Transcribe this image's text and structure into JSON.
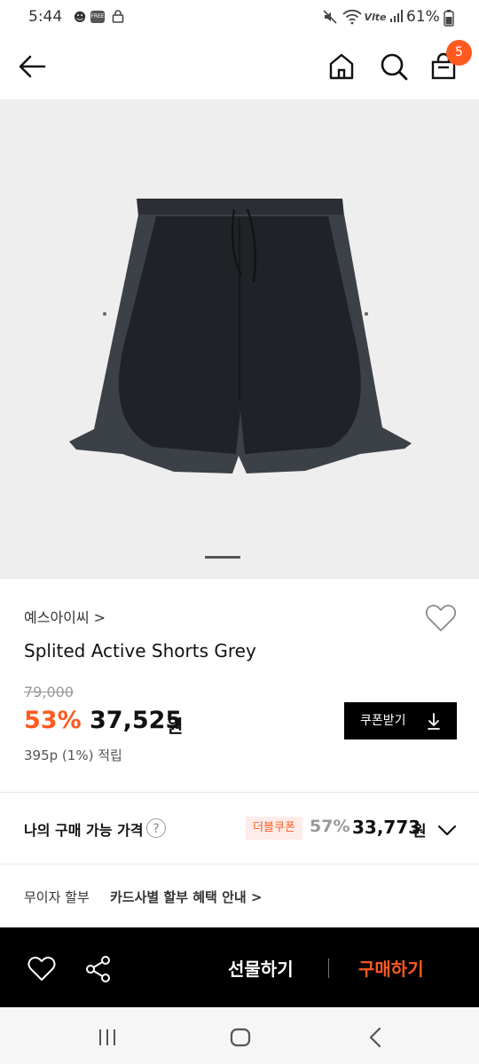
{
  "status_bar": {
    "time": "5:44",
    "battery_percent": "61%",
    "icons": [
      "person-walk-icon",
      "free-badge-icon",
      "lock-icon",
      "mute-icon",
      "wifi-icon",
      "volte-icon",
      "signal-icon",
      "battery-icon"
    ]
  },
  "header": {
    "cart_count": "5",
    "icons": [
      "back-arrow-icon",
      "home-icon",
      "search-icon",
      "cart-icon"
    ]
  },
  "gallery": {
    "slide_index": 1,
    "slide_count": 2
  },
  "product": {
    "brand": "예스아이씨 >",
    "title": "Splited Active Shorts Grey",
    "original_price": "79,000",
    "discount": "53%",
    "price": "37,525",
    "currency": "원",
    "points": "395p (1%) 적립",
    "coupon_button": "쿠폰받기"
  },
  "my_best_price": {
    "label": "나의 구매 가능 가격",
    "badge": "더블쿠폰",
    "discount": "57%",
    "price": "33,773",
    "currency": "원"
  },
  "installment": {
    "label": "무이자 할부",
    "link": "카드사별 할부 혜택 안내 >"
  },
  "action_bar": {
    "gift": "선물하기",
    "buy": "구매하기"
  },
  "colors": {
    "accent": "#ff5a1f",
    "action_bar_bg": "#000000",
    "hero_bg": "#eeeeee"
  }
}
